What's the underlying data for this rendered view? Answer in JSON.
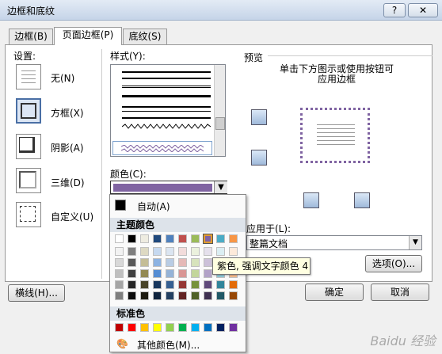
{
  "window": {
    "title": "边框和底纹",
    "help": "?",
    "close": "✕"
  },
  "tabs": [
    {
      "label": "边框(B)"
    },
    {
      "label": "页面边框(P)"
    },
    {
      "label": "底纹(S)"
    }
  ],
  "settings": {
    "heading": "设置:",
    "items": [
      {
        "label": "无(N)"
      },
      {
        "label": "方框(X)"
      },
      {
        "label": "阴影(A)"
      },
      {
        "label": "三维(D)"
      },
      {
        "label": "自定义(U)"
      }
    ]
  },
  "style": {
    "heading": "样式(Y):"
  },
  "color": {
    "heading": "颜色(C):",
    "selected": "#8064a2"
  },
  "preview": {
    "heading": "预览",
    "hint": "单击下方图示或使用按钮可应用边框"
  },
  "apply_to": {
    "heading": "应用于(L):",
    "value": "整篇文档"
  },
  "buttons": {
    "options": "选项(O)...",
    "horizontal_line": "横线(H)...",
    "ok": "确定",
    "cancel": "取消"
  },
  "palette": {
    "auto_label": "自动(A)",
    "theme_heading": "主题颜色",
    "standard_heading": "标准色",
    "more_colors": "其他颜色(M)...",
    "theme_top": [
      "#ffffff",
      "#000000",
      "#eeece1",
      "#1f497d",
      "#4f81bd",
      "#c0504d",
      "#9bbb59",
      "#8064a2",
      "#4bacc6",
      "#f79646"
    ],
    "theme_shades": [
      [
        "#f2f2f2",
        "#7f7f7f",
        "#ddd9c3",
        "#c6d9f0",
        "#dbe5f1",
        "#f2dcdb",
        "#ebf1dd",
        "#e5e0ec",
        "#dbeef3",
        "#fdeada"
      ],
      [
        "#d8d8d8",
        "#595959",
        "#c4bd97",
        "#8db3e2",
        "#b8cce4",
        "#e5b9b7",
        "#d7e3bc",
        "#ccc1d9",
        "#b7dde8",
        "#fbd5b5"
      ],
      [
        "#bfbfbf",
        "#3f3f3f",
        "#938953",
        "#548dd4",
        "#95b3d7",
        "#d99694",
        "#c3d69b",
        "#b2a2c7",
        "#92cddc",
        "#fac08f"
      ],
      [
        "#a5a5a5",
        "#262626",
        "#494429",
        "#17365d",
        "#366092",
        "#953734",
        "#76923c",
        "#5f497a",
        "#31859b",
        "#e36c09"
      ],
      [
        "#7f7f7f",
        "#0c0c0c",
        "#1d1b10",
        "#0f243e",
        "#244061",
        "#632423",
        "#4f6128",
        "#3f3151",
        "#205867",
        "#974806"
      ]
    ],
    "standard": [
      "#c00000",
      "#ff0000",
      "#ffc000",
      "#ffff00",
      "#92d050",
      "#00b050",
      "#00b0f0",
      "#0070c0",
      "#002060",
      "#7030a0"
    ],
    "tooltip": "紫色, 强调文字颜色 4"
  },
  "watermark": "Baidu 经验"
}
